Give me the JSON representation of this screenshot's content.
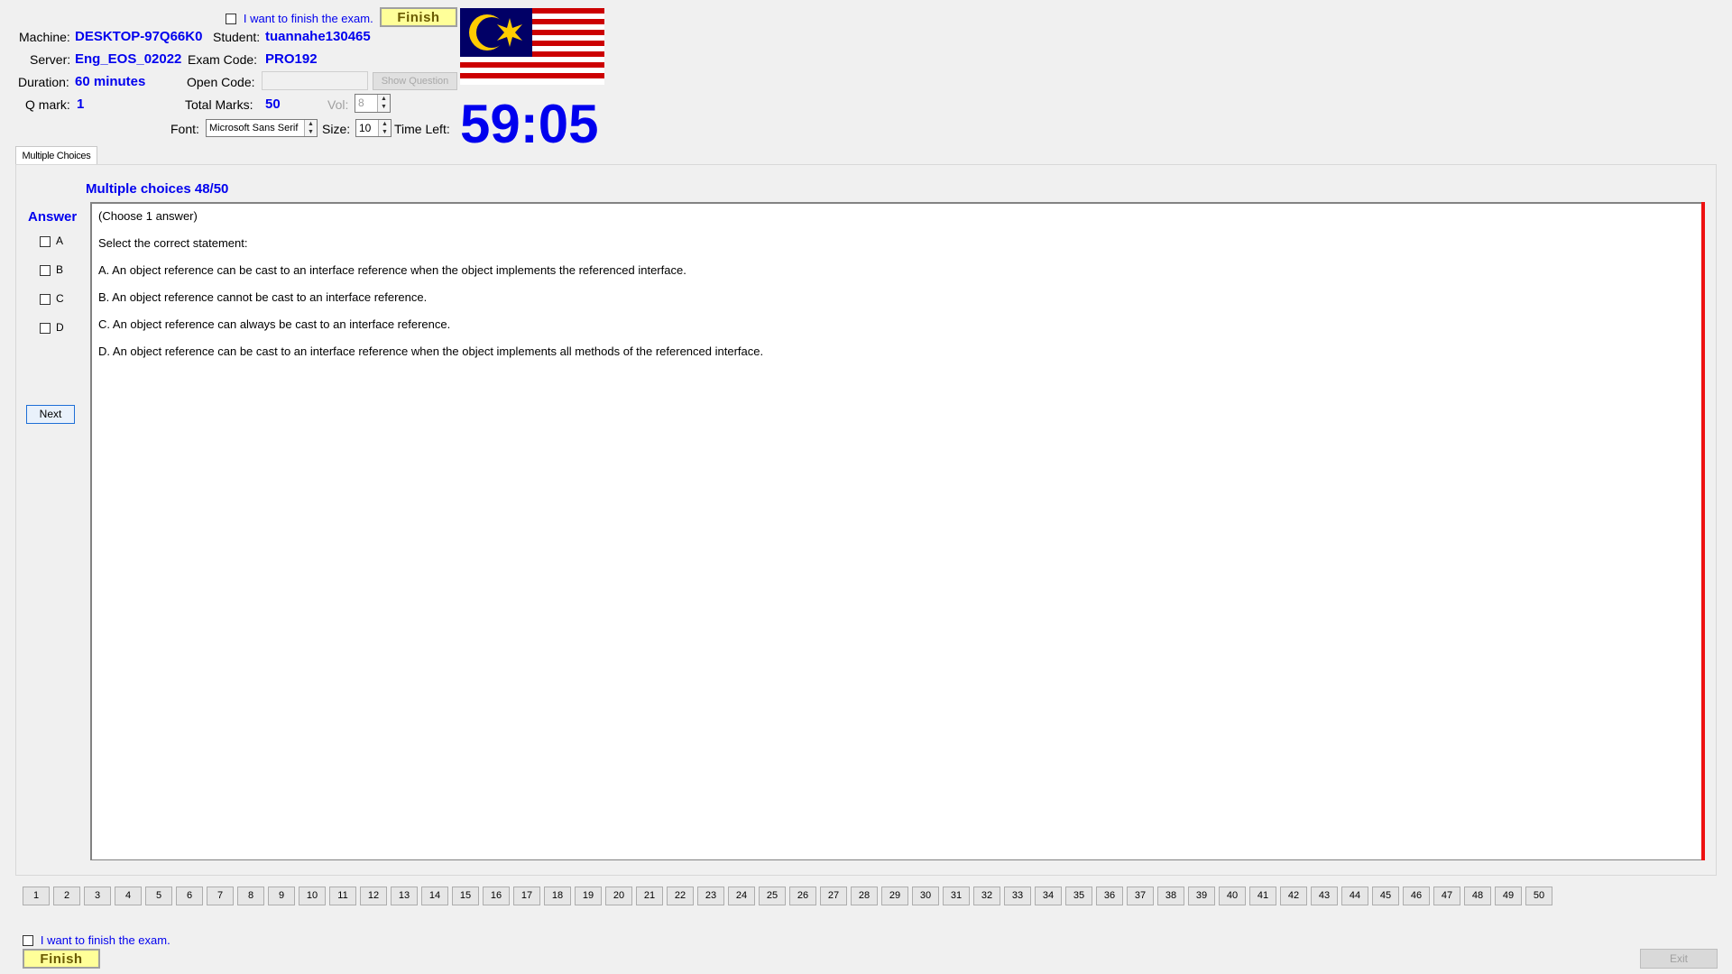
{
  "header": {
    "finish_checkbox_label": "I want to finish the exam.",
    "finish_button": "Finish",
    "machine_label": "Machine:",
    "machine_value": "DESKTOP-97Q66K0",
    "student_label": "Student:",
    "student_value": "tuannahe130465",
    "server_label": "Server:",
    "server_value": "Eng_EOS_02022",
    "exam_code_label": "Exam Code:",
    "exam_code_value": "PRO192",
    "duration_label": "Duration:",
    "duration_value": "60 minutes",
    "open_code_label": "Open Code:",
    "open_code_value": "",
    "show_question_button": "Show Question",
    "qmark_label": "Q mark:",
    "qmark_value": "1",
    "total_marks_label": "Total Marks:",
    "total_marks_value": "50",
    "vol_label": "Vol:",
    "vol_value": "8",
    "font_label": "Font:",
    "font_value": "Microsoft Sans Serif",
    "size_label": "Size:",
    "size_value": "10",
    "time_left_label": "Time Left:",
    "time_left_value": "59:05"
  },
  "tabs": [
    {
      "label": "Multiple Choices"
    }
  ],
  "question": {
    "title": "Multiple choices 48/50",
    "answer_label": "Answer",
    "options": [
      "A",
      "B",
      "C",
      "D"
    ],
    "next_button": "Next",
    "lines": [
      "(Choose 1 answer)",
      "Select the correct statement:",
      "A.  An object reference can be cast to an interface reference when the object implements the referenced interface.",
      "B.  An object reference cannot be cast to an interface reference.",
      "C.  An object reference can always be cast to an interface reference.",
      "D.  An object reference can be cast to an interface reference when the object implements all methods of the referenced interface."
    ]
  },
  "question_nav": [
    "1",
    "2",
    "3",
    "4",
    "5",
    "6",
    "7",
    "8",
    "9",
    "10",
    "11",
    "12",
    "13",
    "14",
    "15",
    "16",
    "17",
    "18",
    "19",
    "20",
    "21",
    "22",
    "23",
    "24",
    "25",
    "26",
    "27",
    "28",
    "29",
    "30",
    "31",
    "32",
    "33",
    "34",
    "35",
    "36",
    "37",
    "38",
    "39",
    "40",
    "41",
    "42",
    "43",
    "44",
    "45",
    "46",
    "47",
    "48",
    "49",
    "50"
  ],
  "footer": {
    "finish_checkbox_label": "I want to finish the exam.",
    "finish_button": "Finish",
    "exit_button": "Exit"
  },
  "colors": {
    "accent_blue": "#0000ee",
    "finish_yellow": "#ffff99",
    "red_bar": "#ee1111"
  }
}
